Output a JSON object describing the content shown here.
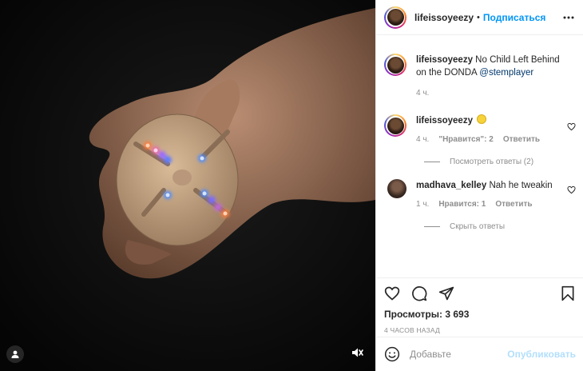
{
  "post": {
    "username": "lifeissoyeezy",
    "separator": "•",
    "follow_label": "Подписаться",
    "more_icon": "more-horizontal-icon"
  },
  "caption": {
    "username": "lifeissoyeezy",
    "text": "No Child Left Behind on the DONDA",
    "mention": "@stemplayer",
    "time": "4 ч."
  },
  "comments": [
    {
      "username": "lifeissoyeezy",
      "emoji": "yellow-circle-emoji",
      "time": "4 ч.",
      "likes": "\"Нравится\": 2",
      "reply_label": "Ответить",
      "view_replies": "Посмотреть ответы (2)"
    },
    {
      "username": "madhava_kelley",
      "text": "Nah he tweakin",
      "time": "1 ч.",
      "likes": "Нравится: 1",
      "reply_label": "Ответить",
      "hide_replies": "Скрыть ответы"
    }
  ],
  "views": "Просмотры: 3 693",
  "posted_ago": "4 ЧАСОВ НАЗАД",
  "comment_box": {
    "placeholder": "Добавьте",
    "publish_label": "Опубликовать"
  },
  "colors": {
    "accent": "#0095f6",
    "publish_disabled": "#b2dffc",
    "muted": "#8e8e8e",
    "text": "#262626"
  }
}
